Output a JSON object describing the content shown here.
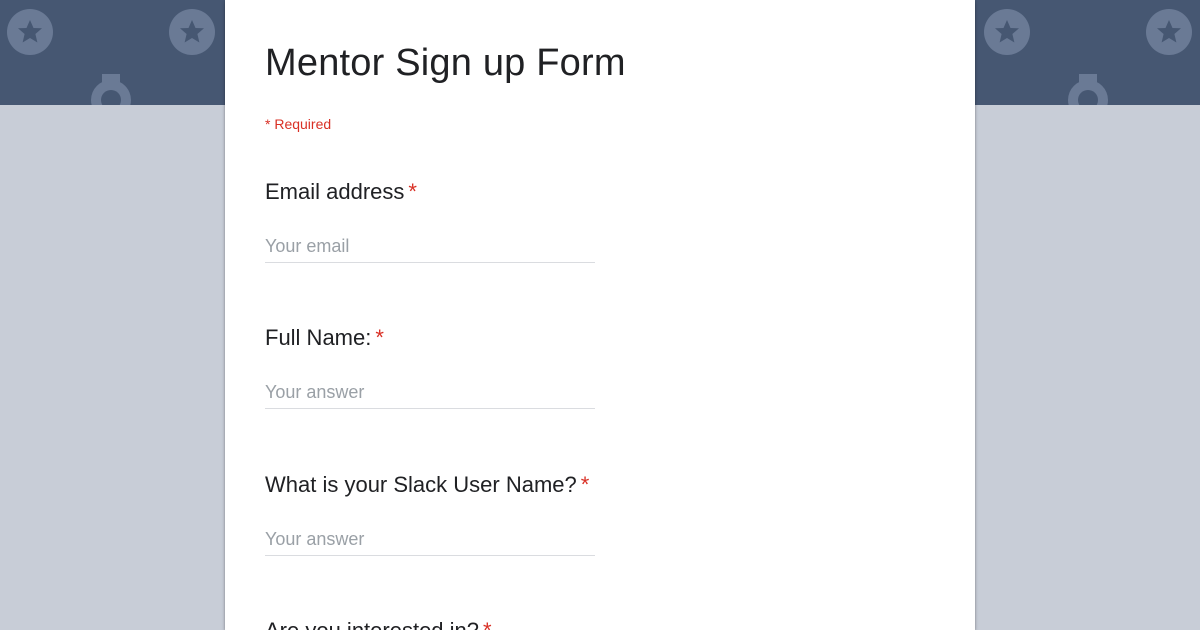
{
  "form": {
    "title": "Mentor Sign up Form",
    "required_note": "* Required",
    "required_marker": "*",
    "questions": [
      {
        "label": "Email address",
        "placeholder": "Your email"
      },
      {
        "label": "Full Name:",
        "placeholder": "Your answer"
      },
      {
        "label": "What is your Slack User Name?",
        "placeholder": "Your answer"
      },
      {
        "label": "Are you interested in?"
      }
    ]
  },
  "colors": {
    "header_band": "#465772",
    "page_background": "#c8cdd7",
    "required": "#d93025"
  },
  "icons": [
    "medal-icon"
  ]
}
